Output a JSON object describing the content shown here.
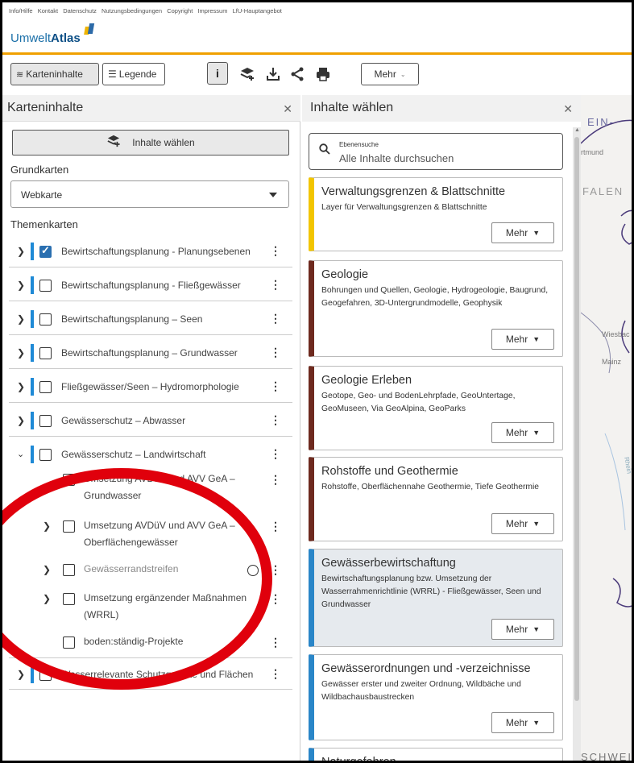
{
  "top_links": [
    "Info/Hilfe",
    "Kontakt",
    "Datenschutz",
    "Nutzungsbedingungen",
    "Copyright",
    "Impressum",
    "LfU-Hauptangebot"
  ],
  "logo": {
    "prefix": "Umwelt",
    "bold": "Atlas"
  },
  "toolbar": {
    "karteninhalte": "Karteninhalte",
    "legende": "Legende",
    "mehr": "Mehr"
  },
  "left_panel": {
    "title": "Karteninhalte",
    "choose_button": "Inhalte wählen",
    "grundkarten_label": "Grundkarten",
    "grundkarte_selected": "Webkarte",
    "themenkarten_label": "Themenkarten",
    "themes": [
      {
        "label": "Bewirtschaftungsplanung - Planungsebenen",
        "checked": true,
        "expanded": false
      },
      {
        "label": "Bewirtschaftungsplanung - Fließgewässer",
        "checked": false,
        "expanded": false
      },
      {
        "label": "Bewirtschaftungsplanung – Seen",
        "checked": false,
        "expanded": false
      },
      {
        "label": "Bewirtschaftungsplanung – Grundwasser",
        "checked": false,
        "expanded": false
      },
      {
        "label": "Fließgewässer/Seen – Hydromorphologie",
        "checked": false,
        "expanded": false
      },
      {
        "label": "Gewässerschutz – Abwasser",
        "checked": false,
        "expanded": false
      },
      {
        "label": "Gewässerschutz – Landwirtschaft",
        "checked": false,
        "expanded": true
      }
    ],
    "sub_items": [
      {
        "line1": "Umsetzung AVDüV und AVV GeA –",
        "line2": "Grundwasser"
      },
      {
        "line1": "Umsetzung AVDüV und AVV GeA –",
        "line2": "Oberflächengewässer"
      },
      {
        "line1": "Gewässerrandstreifen",
        "line2": ""
      },
      {
        "line1": "Umsetzung ergänzender Maßnahmen",
        "line2": "(WRRL)"
      },
      {
        "line1": "boden:ständig-Projekte",
        "line2": ""
      }
    ],
    "last_theme": "Wasserrelevante Schutzgebiete und Flächen"
  },
  "right_panel": {
    "title": "Inhalte wählen",
    "search_caption": "Ebenensuche",
    "search_placeholder": "Alle Inhalte durchsuchen",
    "more_label": "Mehr",
    "cards": [
      {
        "title": "Verwaltungsgrenzen & Blattschnitte",
        "desc": "Layer für Verwaltungsgrenzen & Blattschnitte",
        "color": "#f2c500"
      },
      {
        "title": "Geologie",
        "desc": "Bohrungen und Quellen, Geologie, Hydrogeologie, Baugrund, Geogefahren, 3D-Untergrundmodelle, Geophysik",
        "color": "#6e2a1f"
      },
      {
        "title": "Geologie Erleben",
        "desc": "Geotope, Geo- und BodenLehrpfade, GeoUntertage, GeoMuseen, Via GeoAlpina, GeoParks",
        "color": "#6e2a1f"
      },
      {
        "title": "Rohstoffe und Geothermie",
        "desc": "Rohstoffe, Oberflächennahe Geothermie, Tiefe Geothermie",
        "color": "#6e2a1f"
      },
      {
        "title": "Gewässerbewirtschaftung",
        "desc": "Bewirtschaftungsplanung bzw. Umsetzung der Wasserrahmenrichtlinie (WRRL) - Fließgewässer, Seen und Grundwasser",
        "color": "#2a86c8"
      },
      {
        "title": "Gewässerordnungen und -verzeichnisse",
        "desc": "Gewässer erster und zweiter Ordnung, Wildbäche und Wildbachausbaustrecken",
        "color": "#2a86c8"
      },
      {
        "title": "Naturgefahren",
        "desc": "",
        "color": "#2a86c8"
      }
    ]
  },
  "map": {
    "labels": [
      "EIN-",
      "rtmund",
      "FALEN",
      "Wiesbac",
      "Mainz",
      "Rhein",
      "SCHWEI"
    ]
  }
}
